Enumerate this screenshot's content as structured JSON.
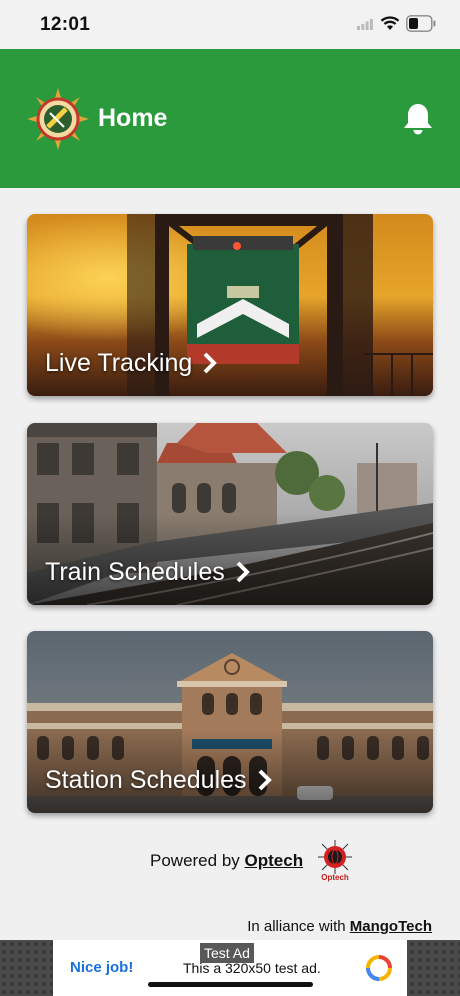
{
  "status_bar": {
    "time": "12:01"
  },
  "header": {
    "title": "Home",
    "bg_color": "#2a9a3c"
  },
  "cards": [
    {
      "label": "Live Tracking"
    },
    {
      "label": "Train Schedules"
    },
    {
      "label": "Station Schedules"
    }
  ],
  "footer": {
    "powered_prefix": "Powered by",
    "powered_link": "Optech",
    "logo_caption": "Optech",
    "alliance_prefix": "In alliance with",
    "alliance_link": "MangoTech"
  },
  "ad": {
    "badge": "Test Ad",
    "cta": "Nice job!",
    "text": "This a 320x50 test ad."
  },
  "icons": {
    "app_logo": "railway-emblem-icon",
    "notification": "bell-icon",
    "card_arrow": "chevron-right-icon"
  }
}
